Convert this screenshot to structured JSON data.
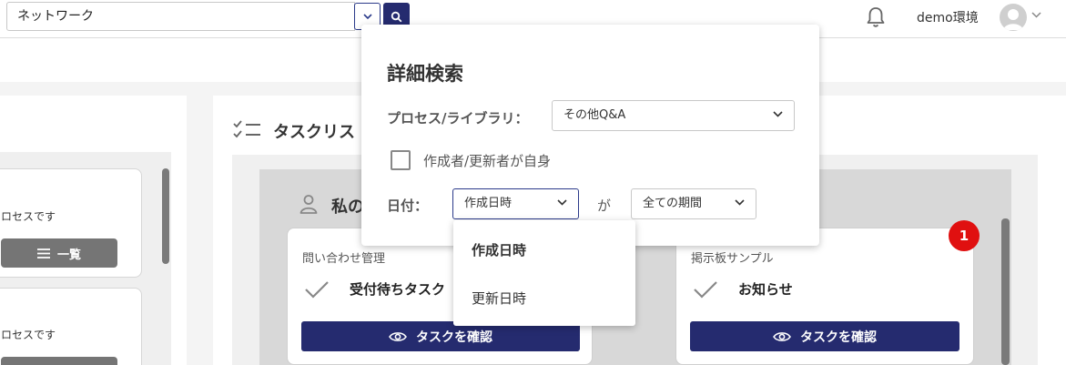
{
  "header": {
    "search_value": "ネットワーク",
    "env_label": "demo環境"
  },
  "left_panel": {
    "cards": [
      {
        "desc": "ロセスです",
        "button_label": "一覧"
      },
      {
        "desc": "ロセスです"
      }
    ]
  },
  "task_list": {
    "title": "タスクリス",
    "group_title": "私の",
    "cards": [
      {
        "category": "問い合わせ管理",
        "name": "受付待ちタスク",
        "button_label": "タスクを確認"
      },
      {
        "category": "掲示板サンプル",
        "name": "お知らせ",
        "button_label": "タスクを確認"
      }
    ],
    "badge": "1"
  },
  "advanced_search": {
    "title": "詳細検索",
    "process_label": "プロセス/ライブラリ：",
    "process_value": "その他Q&A",
    "creator_checkbox_label": "作成者/更新者が自身",
    "date_label": "日付：",
    "date_type_value": "作成日時",
    "connector": "が",
    "period_value": "全ての期間"
  },
  "date_type_menu": {
    "options": [
      "作成日時",
      "更新日時"
    ],
    "selected": "作成日時"
  },
  "colors": {
    "primary": "#252b6f",
    "badge": "#e01010",
    "secondary_button": "#757575"
  }
}
